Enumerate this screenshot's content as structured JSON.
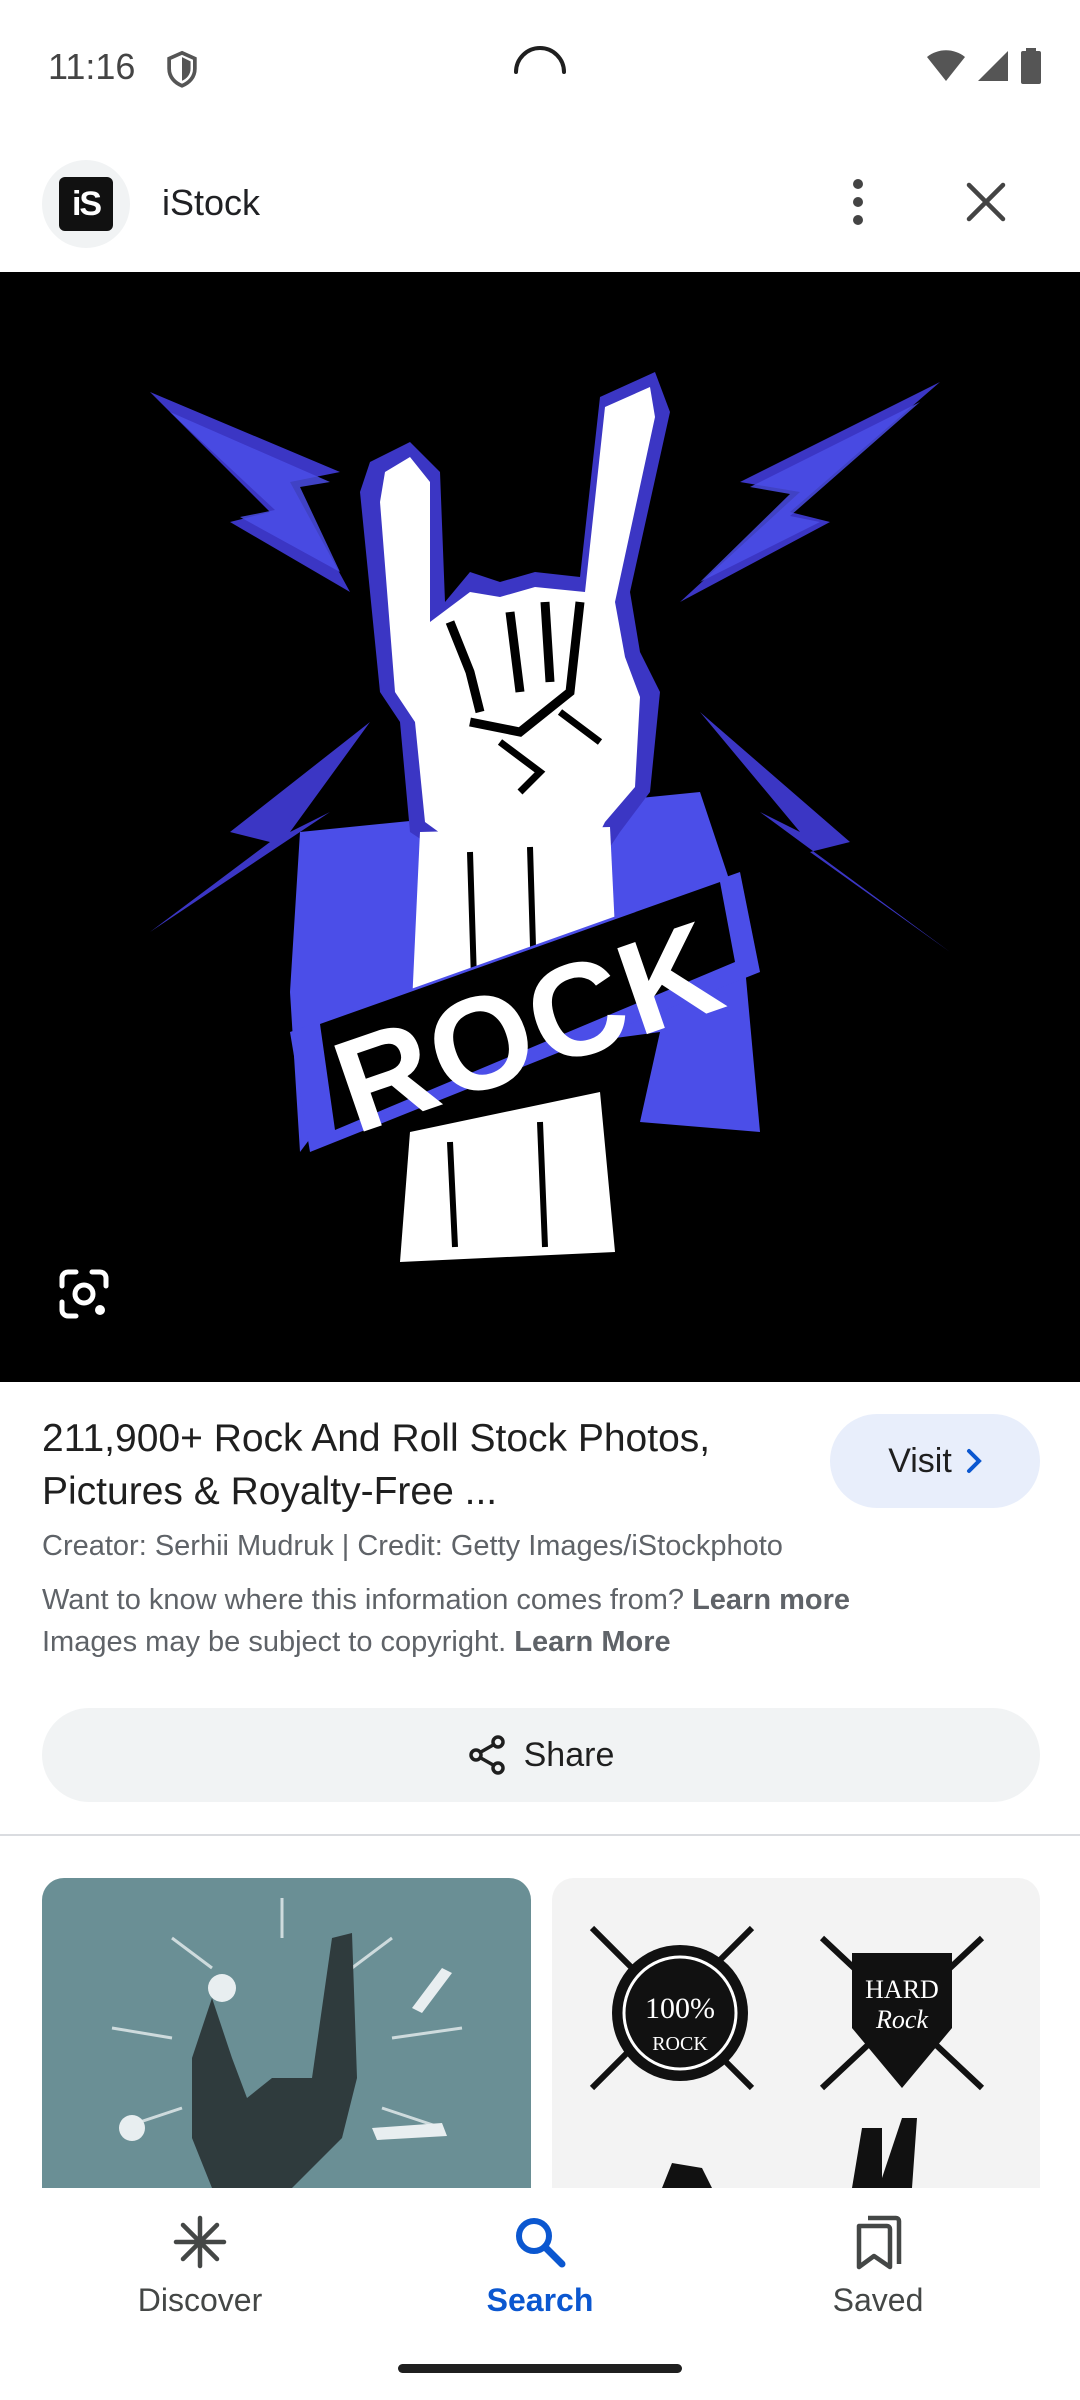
{
  "status_bar": {
    "time": "11:16",
    "icons": [
      "shield-icon",
      "loading-spinner-icon",
      "wifi-icon",
      "cellular-signal-icon",
      "battery-icon"
    ]
  },
  "app_bar": {
    "site_logo_text": "iS",
    "site_name": "iStock",
    "icons": [
      "more-vert-icon",
      "close-icon"
    ]
  },
  "hero_image": {
    "banner_text": "ROCK",
    "lens_icon": "google-lens-icon",
    "colors": {
      "background": "#000000",
      "accent": "#4b4ee8",
      "hand": "#ffffff"
    }
  },
  "result": {
    "title": "211,900+ Rock And Roll Stock Photos, Pictures & Royalty-Free ...",
    "visit_label": "Visit",
    "creator_line": "Creator: Serhii Mudruk | Credit: Getty Images/iStockphoto",
    "info_question": "Want to know where this information comes from?",
    "info_link": "Learn more",
    "copyright_text": "Images may be subject to copyright.",
    "copyright_link": "Learn More",
    "share_label": "Share"
  },
  "related": {
    "thumb_2_badge_1": "100% ROCK",
    "thumb_2_badge_2": "HARD Rock"
  },
  "bottom_nav": {
    "items": [
      {
        "label": "Discover",
        "icon": "discover-asterisk-icon",
        "active": false
      },
      {
        "label": "Search",
        "icon": "search-icon",
        "active": true
      },
      {
        "label": "Saved",
        "icon": "saved-bookmarks-icon",
        "active": false
      }
    ],
    "active_color": "#0b57d0"
  }
}
